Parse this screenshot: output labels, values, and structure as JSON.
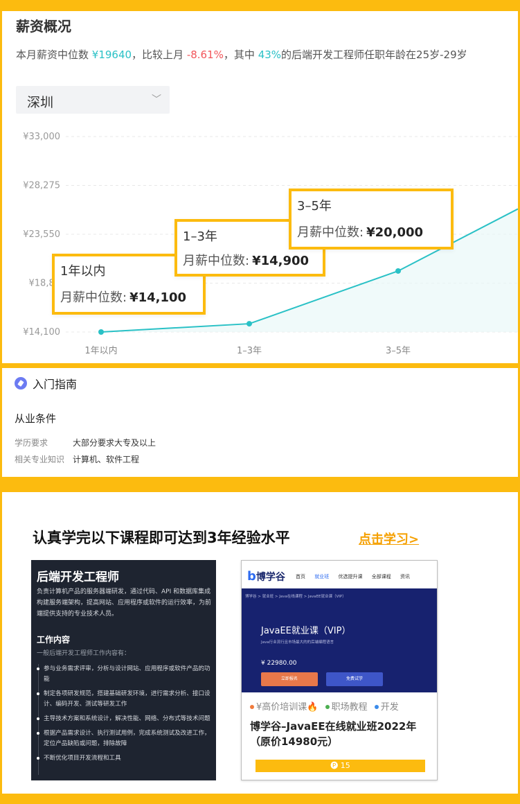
{
  "salary": {
    "title": "薪资概况",
    "summary": {
      "part1": "本月薪资中位数 ",
      "median": "¥19640",
      "part2": "，比较上月 ",
      "change": "-8.61%",
      "part3": "，其中 ",
      "percent": "43%",
      "part4": "的后端开发工程师任职年龄在25岁-29岁"
    },
    "city": "深圳"
  },
  "chart_data": {
    "type": "line",
    "categories": [
      "1年以内",
      "1–3年",
      "3–5年"
    ],
    "values": [
      14100,
      14900,
      20000
    ],
    "extra_series_tail": 26000,
    "yticks": [
      "¥33,000",
      "¥28,275",
      "¥23,550",
      "¥18,82",
      "¥14,100"
    ],
    "ytick_values": [
      33000,
      28275,
      23550,
      18825,
      14100
    ],
    "ylim": [
      14100,
      33000
    ],
    "grid": true,
    "colors": {
      "line": "#2AC1C6",
      "area": "#E9F8F8"
    }
  },
  "tooltips": [
    {
      "label": "1年以内",
      "line_prefix": "月薪中位数:",
      "value": "¥14,100"
    },
    {
      "label": "1–3年",
      "line_prefix": "月薪中位数:",
      "value": "¥14,900"
    },
    {
      "label": "3–5年",
      "line_prefix": "月薪中位数:",
      "value": "¥20,000"
    }
  ],
  "guide": {
    "title": "入门指南",
    "condition_title": "从业条件",
    "rows": [
      {
        "key": "学历要求",
        "value": "大部分要求大专及以上"
      },
      {
        "key": "相关专业知识",
        "value": "计算机、软件工程"
      }
    ]
  },
  "promo": {
    "heading": "认真学完以下课程即可达到3年经验水平",
    "link": "点击学习>"
  },
  "role_card": {
    "title": "后端开发工程师",
    "desc": "负责计算机产品的服务器端研发，通过代码、API 和数据库集成构建服务端架构，提高网站、应用程序或软件的运行效率，为前端提供支持的专业技术人员。",
    "sub": "工作内容",
    "intro": "一般后端开发工程师工作内容有：",
    "items": [
      "参与业务需求评审，分析与设计网站、应用程序或软件产品的功能",
      "制定各项研发规范，搭建基础研发环境，进行需求分析、接口设计、编码开发、测试等研发工作",
      "主导技术方案和系统设计，解决性能、网络、分布式等技术问题",
      "根据产品需求设计、执行测试用例，完成系统测试及改进工作，定位产品缺陷或问题，排除故障",
      "不断优化项目开发流程和工具"
    ]
  },
  "course_card": {
    "logo": "博学谷",
    "nav": [
      "首页",
      "就业班",
      "优选提升课",
      "全部课程",
      "资讯"
    ],
    "crumb": "博学谷 > 就业班 > Java在线课程 > JavaEE就业课（VIP）",
    "banner_title": "JavaEE就业课（VIP）",
    "banner_sub": "Java行业流行且市场最大的的后端编程语言",
    "price": "¥ 22980.00",
    "btn_signup": "立即报名",
    "btn_trial": "免费试学",
    "tags": [
      "¥高价培训课🔥",
      "职场教程",
      "开发"
    ],
    "tag_colors": [
      "#F07A3C",
      "#4CAF50",
      "#3B8BEA"
    ],
    "name": "博学谷–JavaEE在线就业班2022年（原价14980元）",
    "count": "15"
  }
}
